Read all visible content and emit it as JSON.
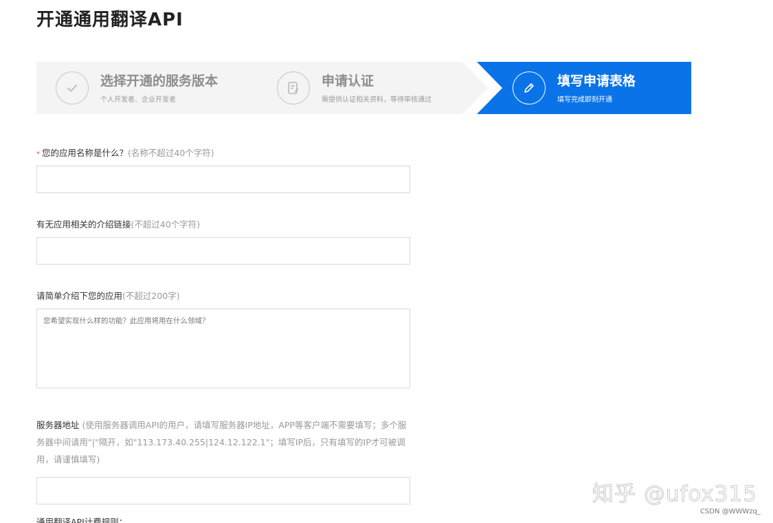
{
  "page": {
    "title": "开通通用翻译API"
  },
  "steps": [
    {
      "title": "选择开通的服务版本",
      "subtitle": "个人开发者、企业开发者",
      "state": "done",
      "icon": "check-icon"
    },
    {
      "title": "申请认证",
      "subtitle": "需提供认证相关资料，等待审核通过",
      "state": "pending",
      "icon": "form-edit-icon"
    },
    {
      "title": "填写申请表格",
      "subtitle": "填写完成即刻开通",
      "state": "active",
      "icon": "pen-icon"
    }
  ],
  "colors": {
    "accent": "#0a73e8",
    "inactive_step_bg": "#f4f4f4",
    "required": "#e24b4b",
    "hint": "#999999"
  },
  "form": {
    "app_name": {
      "required_mark": "*",
      "label": "您的应用名称是什么？",
      "hint": "(名称不超过40个字符)",
      "value": ""
    },
    "intro_link": {
      "label": "有无应用相关的介绍链接",
      "hint": "(不超过40个字符)",
      "value": ""
    },
    "description": {
      "label": "请简单介绍下您的应用",
      "hint": "(不超过200字)",
      "placeholder": "您希望实现什么样的功能？此应用将用在什么领域？"
    },
    "server_address": {
      "label": "服务器地址",
      "hint": "(使用服务器调用API的用户，请填写服务器IP地址，APP等客户端不需要填写；多个服务器中间请用\"|\"隔开，如\"113.173.40.255|124.12.122.1\"；填写IP后，只有填写的IP才可被调用，请谨慎填写)",
      "value": ""
    },
    "next_section_label": "通用翻译API计费规则："
  },
  "watermarks": {
    "zhihu": "知乎 @ufox315",
    "csdn": "CSDN @WWWzq_"
  }
}
